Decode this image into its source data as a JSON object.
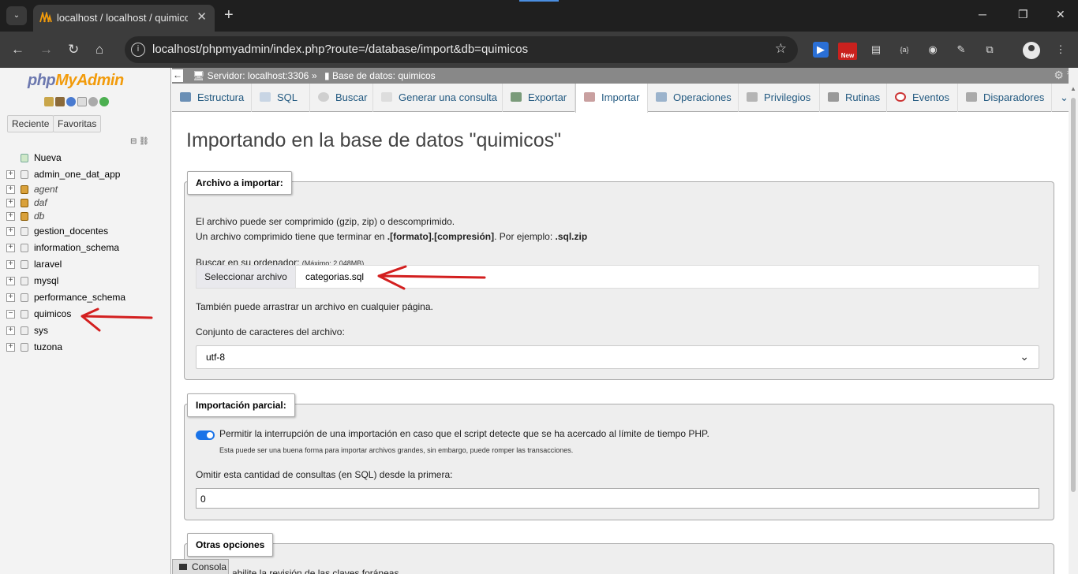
{
  "browser": {
    "tab_title": "localhost / localhost / quimicos",
    "tab_close": "✕",
    "new_tab": "+",
    "url": "localhost/phpmyadmin/index.php?route=/database/import&db=quimicos",
    "ext_new_badge": "New",
    "ext_tag_label": "{a}"
  },
  "sidebar": {
    "logo_php": "php",
    "logo_myadmin": "MyAdmin",
    "tabs": [
      "Reciente",
      "Favoritas"
    ],
    "new_label": "Nueva",
    "databases": [
      {
        "name": "admin_one_dat_app",
        "italic": false
      },
      {
        "name": "agent",
        "italic": true
      },
      {
        "name": "daf",
        "italic": true
      },
      {
        "name": "db",
        "italic": true
      },
      {
        "name": "gestion_docentes",
        "italic": false
      },
      {
        "name": "information_schema",
        "italic": false
      },
      {
        "name": "laravel",
        "italic": false
      },
      {
        "name": "mysql",
        "italic": false
      },
      {
        "name": "performance_schema",
        "italic": false
      },
      {
        "name": "quimicos",
        "italic": false,
        "expanded": true
      },
      {
        "name": "sys",
        "italic": false
      },
      {
        "name": "tuzona",
        "italic": false
      }
    ]
  },
  "breadcrumb": {
    "server": "Servidor: localhost:3306",
    "separator": "»",
    "database": "Base de datos: quimicos"
  },
  "menu": {
    "tabs": [
      "Estructura",
      "SQL",
      "Buscar",
      "Generar una consulta",
      "Exportar",
      "Importar",
      "Operaciones",
      "Privilegios",
      "Rutinas",
      "Eventos",
      "Disparadores"
    ],
    "active": "Importar"
  },
  "main": {
    "title": "Importando en la base de datos \"quimicos\"",
    "file_section": {
      "legend": "Archivo a importar:",
      "line1": "El archivo puede ser comprimido (gzip, zip) o descomprimido.",
      "line2_prefix": "Un archivo comprimido tiene que terminar en ",
      "line2_format": ".[formato].[compresión]",
      "line2_mid": ". Por ejemplo: ",
      "line2_example": ".sql.zip",
      "browse_label": "Buscar en su ordenador:",
      "max_size": "(Máximo: 2,048MB)",
      "choose_button": "Seleccionar archivo",
      "selected_file": "categorias.sql",
      "drag_hint": "También puede arrastrar un archivo en cualquier página.",
      "charset_label": "Conjunto de caracteres del archivo:",
      "charset_value": "utf-8"
    },
    "partial_section": {
      "legend": "Importación parcial:",
      "allow_interrupt_label": "Permitir la interrupción de una importación en caso que el script detecte que se ha acercado al límite de tiempo PHP.",
      "allow_interrupt_checked": true,
      "allow_interrupt_note": "Esta puede ser una buena forma para importar archivos grandes, sin embargo, puede romper las transacciones.",
      "skip_label": "Omitir esta cantidad de consultas (en SQL) desde la primera:",
      "skip_value": "0"
    },
    "other_section": {
      "legend": "Otras opciones",
      "partial_text": "abilite la revisión de las claves foráneas"
    }
  },
  "console": {
    "label": "Consola"
  },
  "colors": {
    "annotation_arrow": "#d31f1f",
    "link_blue": "#235a81",
    "toggle_on": "#1a73e8"
  }
}
